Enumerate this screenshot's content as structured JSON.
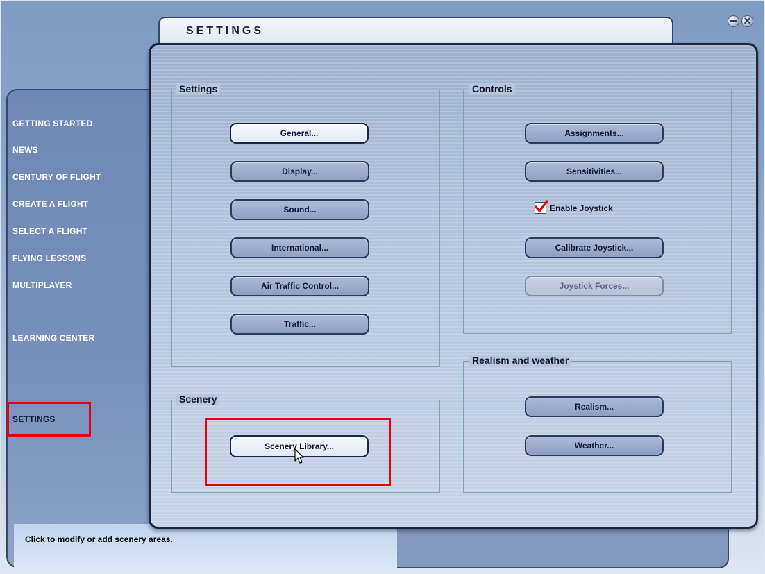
{
  "window": {
    "title": "SETTINGS",
    "minimize_icon": "minimize-icon",
    "close_icon": "close-icon"
  },
  "nav": {
    "items": [
      {
        "label": "GETTING STARTED",
        "active": false
      },
      {
        "label": "NEWS",
        "active": false
      },
      {
        "label": "CENTURY OF FLIGHT",
        "active": false
      },
      {
        "label": "CREATE A FLIGHT",
        "active": false
      },
      {
        "label": "SELECT A FLIGHT",
        "active": false
      },
      {
        "label": "FLYING LESSONS",
        "active": false
      },
      {
        "label": "MULTIPLAYER",
        "active": false
      },
      {
        "label": "LEARNING CENTER",
        "active": false
      },
      {
        "label": "SETTINGS",
        "active": true
      }
    ]
  },
  "groups": {
    "settings": {
      "title": "Settings",
      "buttons": [
        "General...",
        "Display...",
        "Sound...",
        "International...",
        "Air Traffic Control...",
        "Traffic..."
      ]
    },
    "controls": {
      "title": "Controls",
      "buttons": [
        "Assignments...",
        "Sensitivities...",
        "Calibrate Joystick...",
        "Joystick Forces..."
      ],
      "checkbox": {
        "label": "Enable Joystick",
        "checked": true
      }
    },
    "scenery": {
      "title": "Scenery",
      "buttons": [
        "Scenery Library..."
      ]
    },
    "realism": {
      "title": "Realism and weather",
      "buttons": [
        "Realism...",
        "Weather..."
      ]
    }
  },
  "status": {
    "text": "Click to modify or add scenery areas."
  },
  "colors": {
    "highlight": "#e50012",
    "panel_border": "#1c2640",
    "check": "#e50012"
  }
}
